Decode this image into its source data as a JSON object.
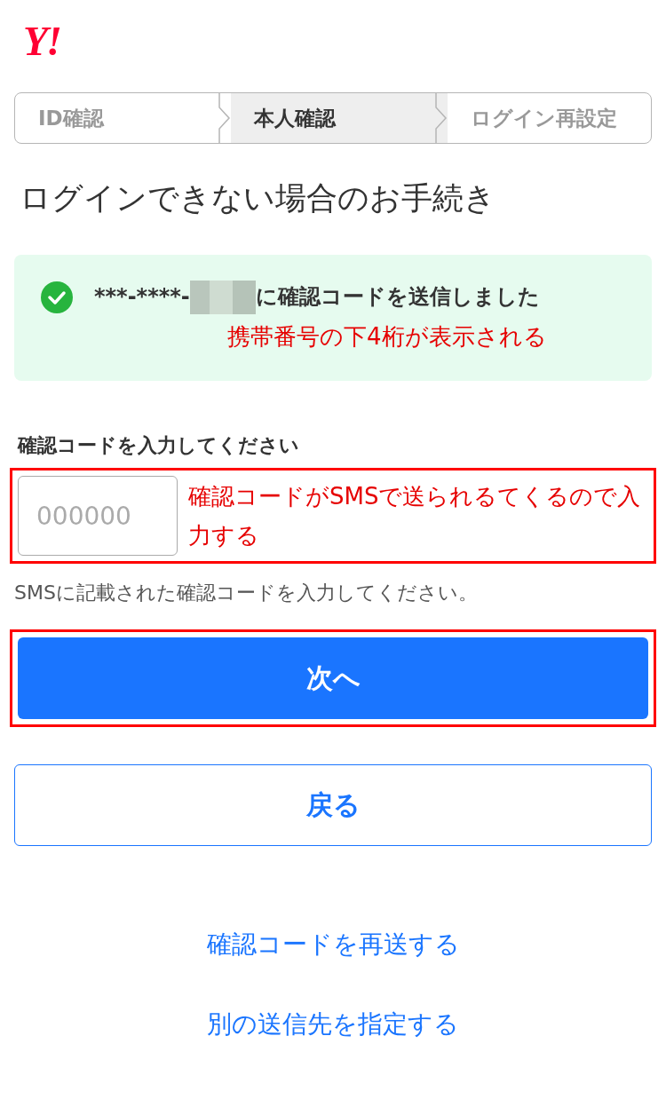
{
  "logo": {
    "text": "Y!"
  },
  "steps": [
    {
      "label": "ID確認",
      "selected": false
    },
    {
      "label": "本人確認",
      "selected": true
    },
    {
      "label": "ログイン再設定",
      "selected": false
    }
  ],
  "title": "ログインできない場合のお手続き",
  "message": {
    "prefix": "***-****-",
    "suffix": "に確認コードを送信しました",
    "annotation": "携帯番号の下4桁が表示される"
  },
  "code_field": {
    "label": "確認コードを入力してください",
    "placeholder": "000000",
    "annotation": "確認コードがSMSで送られるてくるので入力する",
    "help": "SMSに記載された確認コードを入力してください。"
  },
  "buttons": [
    {
      "label": "次へ",
      "kind": "primary",
      "highlighted": true
    },
    {
      "label": "戻る",
      "kind": "secondary",
      "highlighted": false
    }
  ],
  "links": [
    "確認コードを再送する",
    "別の送信先を指定する"
  ]
}
